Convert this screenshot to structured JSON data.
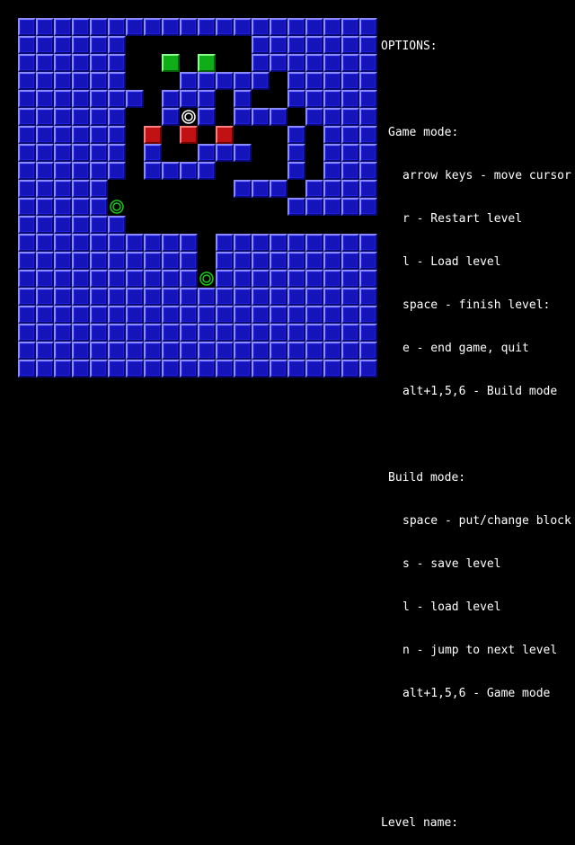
{
  "game": {
    "grid_size": [
      20,
      20
    ],
    "map": [
      "####################",
      "######.......#######",
      "######..G.G..#######",
      "######...#####.#####",
      "#######.###.#..#####",
      "######..#.#.###.####",
      "######.R.R.R...#.###",
      "######.#..###..#.###",
      "######.####....#.###",
      "#####.......###.####",
      "#####T.........#####",
      "######..............#",
      "##########.##########",
      "##########.#########",
      "##########P#########",
      "####################",
      "####################",
      "####################",
      "####################",
      "####################"
    ],
    "colors": {
      "wall": "#1414b8",
      "green_box": "#0fae19",
      "red_box": "#c01212",
      "target_ring": "#18c818",
      "cursor_ring": "#ffffff",
      "background": "#000000"
    }
  },
  "panel": {
    "title": "OPTIONS:",
    "game_mode_header": "Game mode:",
    "game_mode_items": [
      "arrow keys - move cursor",
      "r - Restart level",
      "l - Load level",
      "space - finish level:",
      "e - end game, quit",
      "alt+1,5,6 - Build mode"
    ],
    "build_mode_header": "Build mode:",
    "build_mode_items": [
      "space - put/change block",
      "s - save level",
      "l - load level",
      "n - jump to next level",
      "alt+1,5,6 - Game mode"
    ],
    "level_name_label": "Level name:"
  }
}
